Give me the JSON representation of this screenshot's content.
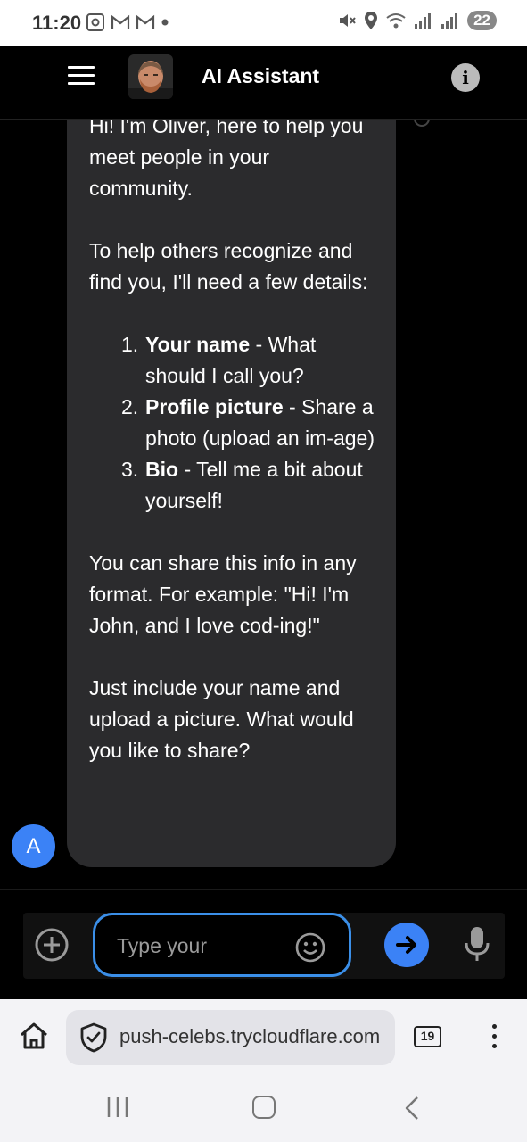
{
  "status_bar": {
    "time": "11:20",
    "battery": "22",
    "left_icons": [
      "screenshot-icon",
      "gmail-icon",
      "gmail-icon",
      "dot-icon"
    ],
    "right_icons": [
      "mute-icon",
      "location-icon",
      "wifi-icon",
      "signal-icon",
      "signal-icon"
    ]
  },
  "header": {
    "title": "AI Assistant",
    "info_label": "i",
    "menu_icon": "hamburger-icon"
  },
  "chat": {
    "greeting_line": "Hi! I'm Oliver, here to help you meet people in your community.",
    "intro": "To help others recognize and find you, I'll need a few details:",
    "items": [
      {
        "num": "1.",
        "title": "Your name",
        "desc": " - What should I call you?"
      },
      {
        "num": "2.",
        "title": "Profile picture",
        "desc": " - Share a photo (upload an im-age)"
      },
      {
        "num": "3.",
        "title": "Bio",
        "desc": " - Tell me a bit about yourself!"
      }
    ],
    "format_note": "You can share this info in any format. For example: \"Hi! I'm John, and I love cod-ing!\"",
    "closing": "Just include your name and upload a picture. What would you like to share?",
    "user_avatar_letter": "A"
  },
  "input": {
    "placeholder": "Type your"
  },
  "browser": {
    "url": "push-celebs.trycloudflare.com",
    "tab_count": "19"
  },
  "colors": {
    "accent": "#3b82f6",
    "bubble": "#2b2b2d",
    "field_border": "#3b8fe8"
  }
}
